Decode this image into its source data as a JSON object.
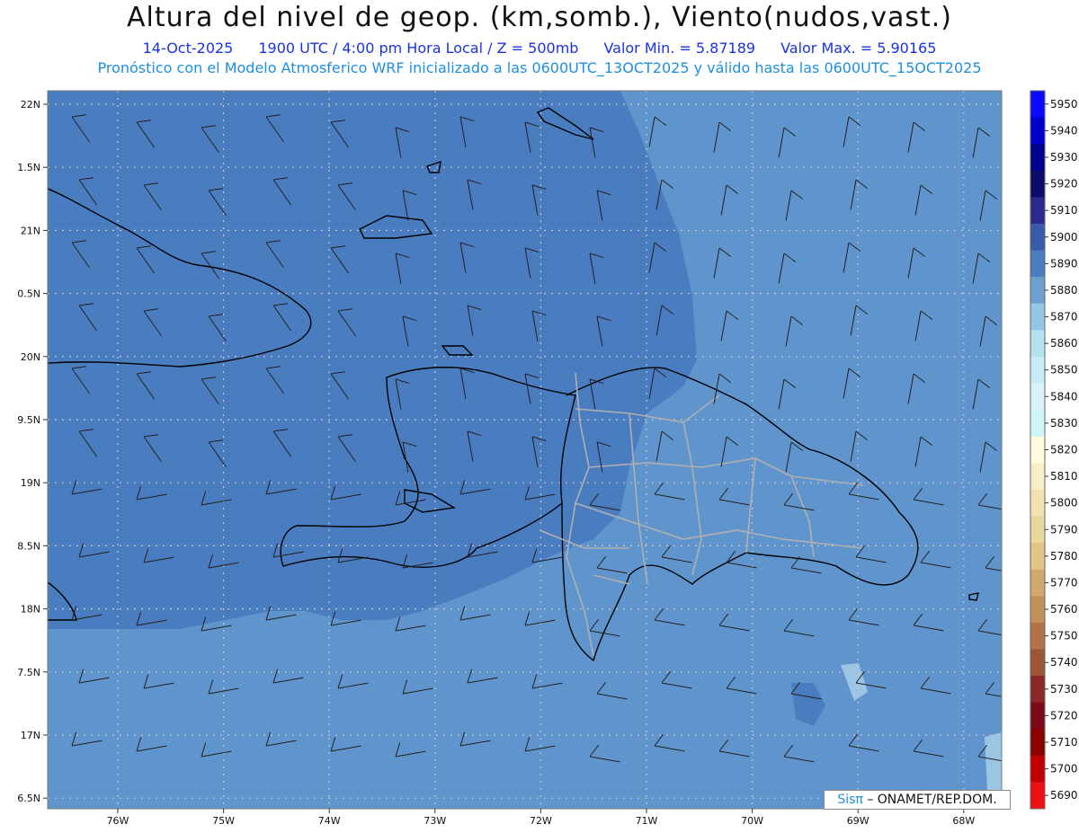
{
  "header": {
    "title": "Altura del nivel de geop. (km,somb.), Viento(nudos,vast.)",
    "date": "14-Oct-2025",
    "time": "1900 UTC / 4:00 pm Hora Local / Z = 500mb",
    "min": "Valor Min. = 5.87189",
    "max": "Valor Max. = 5.90165",
    "subtitle": "Pronóstico con el Modelo Atmosferico WRF inicializado a las 0600UTC_13OCT2025 y válido hasta las  0600UTC_15OCT2025"
  },
  "axes": {
    "lat_labels": [
      "22N",
      "1.5N",
      "21N",
      "0.5N",
      "20N",
      "9.5N",
      "19N",
      "8.5N",
      "18N",
      "7.5N",
      "17N",
      "6.5N"
    ],
    "lon_labels": [
      "76W",
      "75W",
      "74W",
      "73W",
      "72W",
      "71W",
      "70W",
      "69W",
      "68W"
    ]
  },
  "colorbar": {
    "labels": [
      "5950",
      "5940",
      "5930",
      "5920",
      "5910",
      "5900",
      "5890",
      "5880",
      "5870",
      "5860",
      "5850",
      "5840",
      "5830",
      "5820",
      "5810",
      "5800",
      "5790",
      "5780",
      "5770",
      "5760",
      "5750",
      "5740",
      "5730",
      "5720",
      "5710",
      "5700",
      "5690"
    ],
    "colors": [
      "#0a0aff",
      "#0000cc",
      "#000090",
      "#0c0c6a",
      "#2a2a8e",
      "#3a5aaa",
      "#4a7cc0",
      "#6da0d0",
      "#95c7e4",
      "#b5e2f0",
      "#c8ecf6",
      "#daf3fa",
      "#cff5f8",
      "#fffae0",
      "#f8efc8",
      "#f1e3b1",
      "#ead79b",
      "#e2c488",
      "#d3a870",
      "#c4905a",
      "#b27348",
      "#9d5638",
      "#8a2a28",
      "#7a0a18",
      "#8a0000",
      "#c20000",
      "#ee1111"
    ]
  },
  "colors": {
    "field_deep": "#4a7cc0",
    "field_mid": "#5f95cc",
    "field_light": "#9cc4e3"
  },
  "credit": {
    "sis": "Sisπ",
    "rest": "– ONAMET/REP.DOM."
  }
}
